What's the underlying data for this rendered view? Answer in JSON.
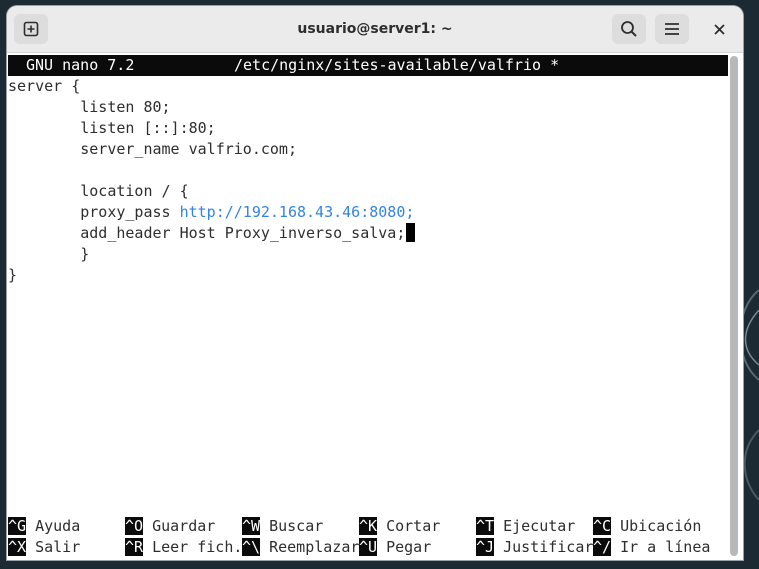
{
  "window": {
    "title": "usuario@server1: ~"
  },
  "titlebar": {
    "new_tab_icon": "plus-square-icon",
    "search_icon": "search-icon",
    "menu_icon": "hamburger-menu-icon",
    "close_icon": "close-icon"
  },
  "nano": {
    "version": "GNU nano 7.2",
    "filename": "/etc/nginx/sites-available/valfrio *"
  },
  "editor": {
    "lines": [
      "server {",
      "        listen 80;",
      "        listen [::]:80;",
      "        server_name valfrio.com;",
      "",
      "        location / {",
      "        proxy_pass ",
      "        add_header Host Proxy_inverso_salva;",
      "        }",
      "}"
    ],
    "url": "http://192.168.43.46:8080;"
  },
  "shortcuts": [
    {
      "key": "^G",
      "label": "Ayuda"
    },
    {
      "key": "^O",
      "label": "Guardar"
    },
    {
      "key": "^W",
      "label": "Buscar"
    },
    {
      "key": "^K",
      "label": "Cortar"
    },
    {
      "key": "^T",
      "label": "Ejecutar"
    },
    {
      "key": "^C",
      "label": "Ubicación"
    },
    {
      "key": "^X",
      "label": "Salir"
    },
    {
      "key": "^R",
      "label": "Leer fich."
    },
    {
      "key": "^\\",
      "label": "Reemplazar"
    },
    {
      "key": "^U",
      "label": "Pegar"
    },
    {
      "key": "^J",
      "label": "Justificar"
    },
    {
      "key": "^/",
      "label": "Ir a línea"
    }
  ],
  "colors": {
    "url": "#3584e4",
    "header_bg": "#0b0b0b"
  }
}
